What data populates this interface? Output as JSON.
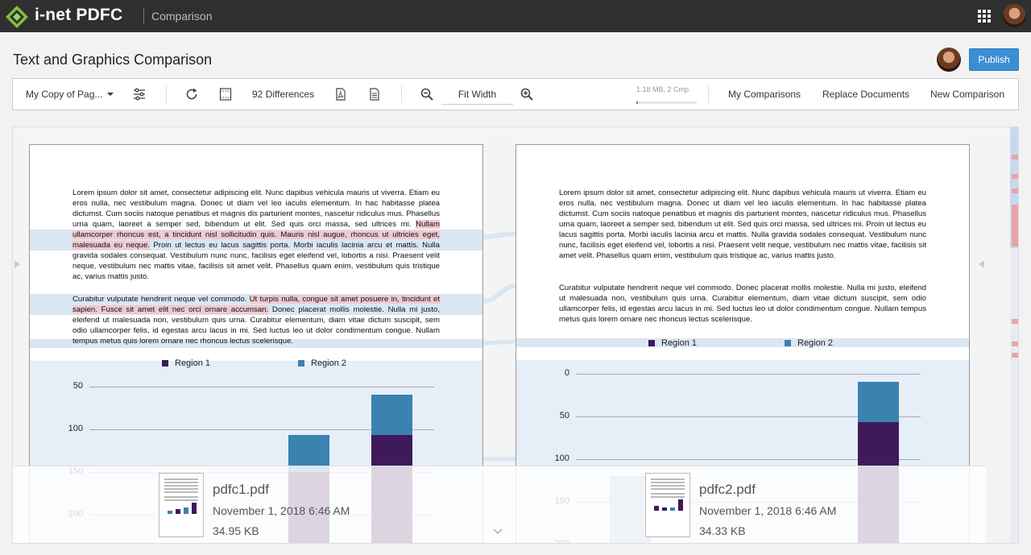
{
  "app": {
    "brand": "i-net PDFC",
    "section": "Comparison"
  },
  "page": {
    "title": "Text and Graphics Comparison",
    "publish_label": "Publish"
  },
  "toolbar": {
    "profile_label": "My Copy of Pag...",
    "differences_label": "92 Differences",
    "zoom_label": "Fit Width",
    "memory_label": "1.18 MB, 2 Cmp.",
    "memory_fraction": 0.03,
    "my_comparisons_label": "My Comparisons",
    "replace_documents_label": "Replace Documents",
    "new_comparison_label": "New Comparison"
  },
  "icons": [
    "settings-sliders-icon",
    "refresh-icon",
    "page-layout-icon",
    "pdf-export-icon",
    "report-icon",
    "zoom-out-icon",
    "zoom-in-icon",
    "apps-grid-icon",
    "chevron-down-icon"
  ],
  "colors": {
    "accent": "#3b8ed4",
    "region1": "#3f1a5a",
    "region2": "#3a82b0",
    "change_highlight": "#dbe6f3",
    "text_mark": "#f0c9cf"
  },
  "left_doc": {
    "para1": [
      {
        "t": "Lorem ipsum dolor sit amet, consectetur adipiscing elit. Nunc dapibus vehicula mauris ut viverra. Etiam eu eros nulla, nec vestibulum magna. Donec ut diam vel leo iaculis elementum. In hac habitasse platea dictumst. Cum sociis natoque penatibus et magnis dis parturient montes, nascetur ridiculus mus. Phasellus urna quam, laoreet a semper sed, bibendum ut elit. Sed quis orci massa, sed ultrices mi. ",
        "m": false
      },
      {
        "t": "Nullam ullamcorper rhoncus est, a tincidunt nisl sollicitudin quis. Mauris nisl augue, rhoncus ut ultricies eget, malesuada eu neque.",
        "m": true
      },
      {
        "t": " Proin ut lectus eu lacus sagittis porta. Morbi iaculis lacinia arcu et mattis. Nulla gravida sodales consequat. Vestibulum nunc nunc, facilisis eget eleifend vel, lobortis a nisi. Praesent velit neque, vestibulum nec mattis vitae, facilisis sit amet velit. Phasellus quam enim, vestibulum quis tristique ac, varius mattis justo.",
        "m": false
      }
    ],
    "para2": [
      {
        "t": "Curabitur vulputate hendrerit neque vel commodo. ",
        "m": false
      },
      {
        "t": "Ut turpis nulla, congue sit amet posuere in, tincidunt et sapien. Fusce sit amet elit nec orci ornare accumsan.",
        "m": true
      },
      {
        "t": " Donec placerat mollis molestie. Nulla mi justo, eleifend ut malesuada non, vestibulum quis urna. Curabitur elementum, diam vitae dictum suscipit, sem odio ullamcorper felis, id egestas arcu lacus in mi. Sed luctus leo ut dolor condimentum congue. Nullam tempus metus quis lorem ornare nec rhoncus lectus scelerisque.",
        "m": false
      }
    ],
    "legend": [
      "Region 1",
      "Region 2"
    ],
    "ticks": [
      "200",
      "150",
      "100",
      "50"
    ]
  },
  "right_doc": {
    "para1": "Lorem ipsum dolor sit amet, consectetur adipiscing elit. Nunc dapibus vehicula mauris ut viverra. Etiam eu eros nulla, nec vestibulum magna. Donec ut diam vel leo iaculis elementum. In hac habitasse platea dictumst. Cum sociis natoque penatibus et magnis dis parturient montes, nascetur ridiculus mus. Phasellus urna quam, laoreet a semper sed, bibendum ut elit. Sed quis orci massa, sed ultrices mi. Proin ut lectus eu lacus sagittis porta. Morbi iaculis lacinia arcu et mattis. Nulla gravida sodales consequat. Vestibulum nunc nunc, facilisis eget eleifend vel, lobortis a nisi. Praesent velit neque, vestibulum nec mattis vitae, facilisis sit amet velit. Phasellus quam enim, vestibulum quis tristique ac, varius mattis justo.",
    "para2": "Curabitur vulputate hendrerit neque vel commodo. Donec placerat mollis molestie. Nulla mi justo, eleifend ut malesuada non, vestibulum quis urna. Curabitur elementum, diam vitae dictum suscipit, sem odio ullamcorper felis, id egestas arcu lacus in mi. Sed luctus leo ut dolor condimentum congue. Nullam tempus metus quis lorem ornare nec rhoncus lectus scelerisque.",
    "legend": [
      "Region 1",
      "Region 2"
    ],
    "ticks": [
      "200",
      "150",
      "100",
      "50",
      "0"
    ]
  },
  "chart_data": [
    {
      "type": "bar",
      "stacked": true,
      "series": [
        {
          "name": "Region 1",
          "values": [
            null,
            100,
            143
          ]
        },
        {
          "name": "Region 2",
          "values": [
            null,
            43,
            48
          ]
        }
      ],
      "ylim": [
        0,
        210
      ],
      "yticks": [
        50,
        100,
        150,
        200
      ]
    },
    {
      "type": "bar",
      "stacked": true,
      "series": [
        {
          "name": "Region 1",
          "values": [
            80,
            null,
            143
          ]
        },
        {
          "name": "Region 2",
          "values": [
            0,
            null,
            48
          ]
        }
      ],
      "ylim": [
        0,
        210
      ],
      "yticks": [
        0,
        50,
        100,
        150,
        200
      ]
    }
  ],
  "files": [
    {
      "name": "pdfc1.pdf",
      "date": "November 1, 2018 6:46 AM",
      "size": "34.95 KB"
    },
    {
      "name": "pdfc2.pdf",
      "date": "November 1, 2018 6:46 AM",
      "size": "34.33 KB"
    }
  ]
}
